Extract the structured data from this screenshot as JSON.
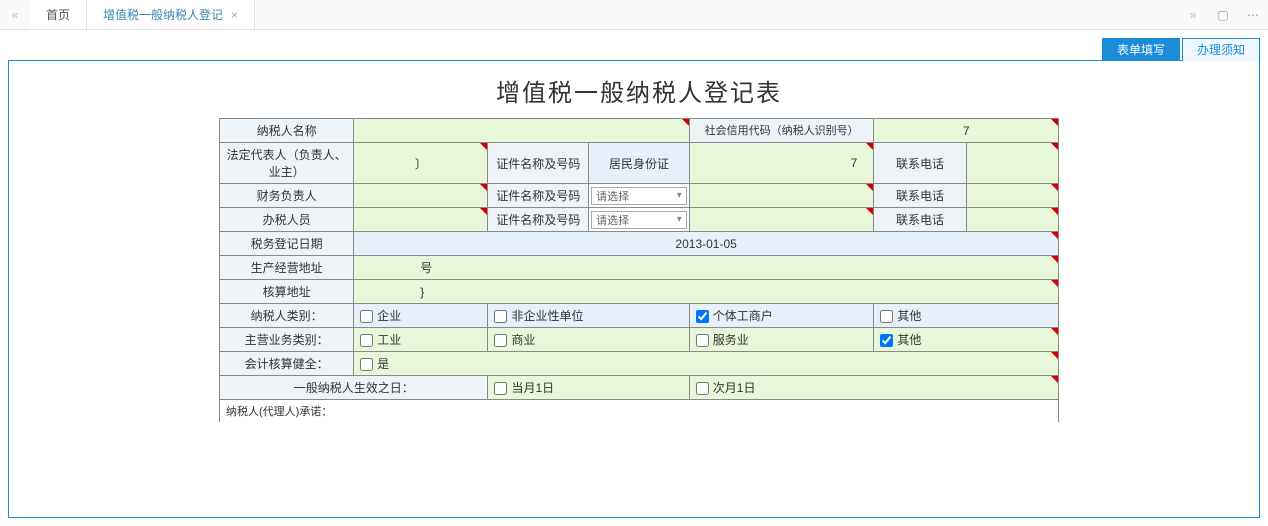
{
  "topbar": {
    "home": "首页",
    "active_tab": "增值税一般纳税人登记"
  },
  "action_tabs": {
    "fill": "表单填写",
    "notice": "办理须知"
  },
  "form": {
    "title": "增值税一般纳税人登记表",
    "labels": {
      "taxpayer_name": "纳税人名称",
      "credit_code": "社会信用代码（纳税人识别号）",
      "legal_rep": "法定代表人（负责人、业主）",
      "cert_name_no": "证件名称及号码",
      "phone": "联系电话",
      "finance_head": "财务负责人",
      "operator": "办税人员",
      "reg_date": "税务登记日期",
      "biz_address": "生产经营地址",
      "calc_address": "核算地址",
      "taxpayer_type": "纳税人类别：",
      "main_biz_type": "主营业务类别：",
      "accounting_sound": "会计核算健全：",
      "effective_date": "一般纳税人生效之日：",
      "promise": "纳税人(代理人)承诺："
    },
    "values": {
      "credit_code_suffix": "7",
      "cert_type_1": "居民身份证",
      "cert_no_1_suffix": "7",
      "select_placeholder": "请选择",
      "reg_date": "2013-01-05",
      "biz_address_suffix": "号"
    },
    "checkboxes": {
      "enterprise": "企业",
      "non_enterprise": "非企业性单位",
      "individual": "个体工商户",
      "other_type": "其他",
      "industry": "工业",
      "commerce": "商业",
      "service": "服务业",
      "other_biz": "其他",
      "yes": "是",
      "current_month": "当月1日",
      "next_month": "次月1日"
    }
  }
}
